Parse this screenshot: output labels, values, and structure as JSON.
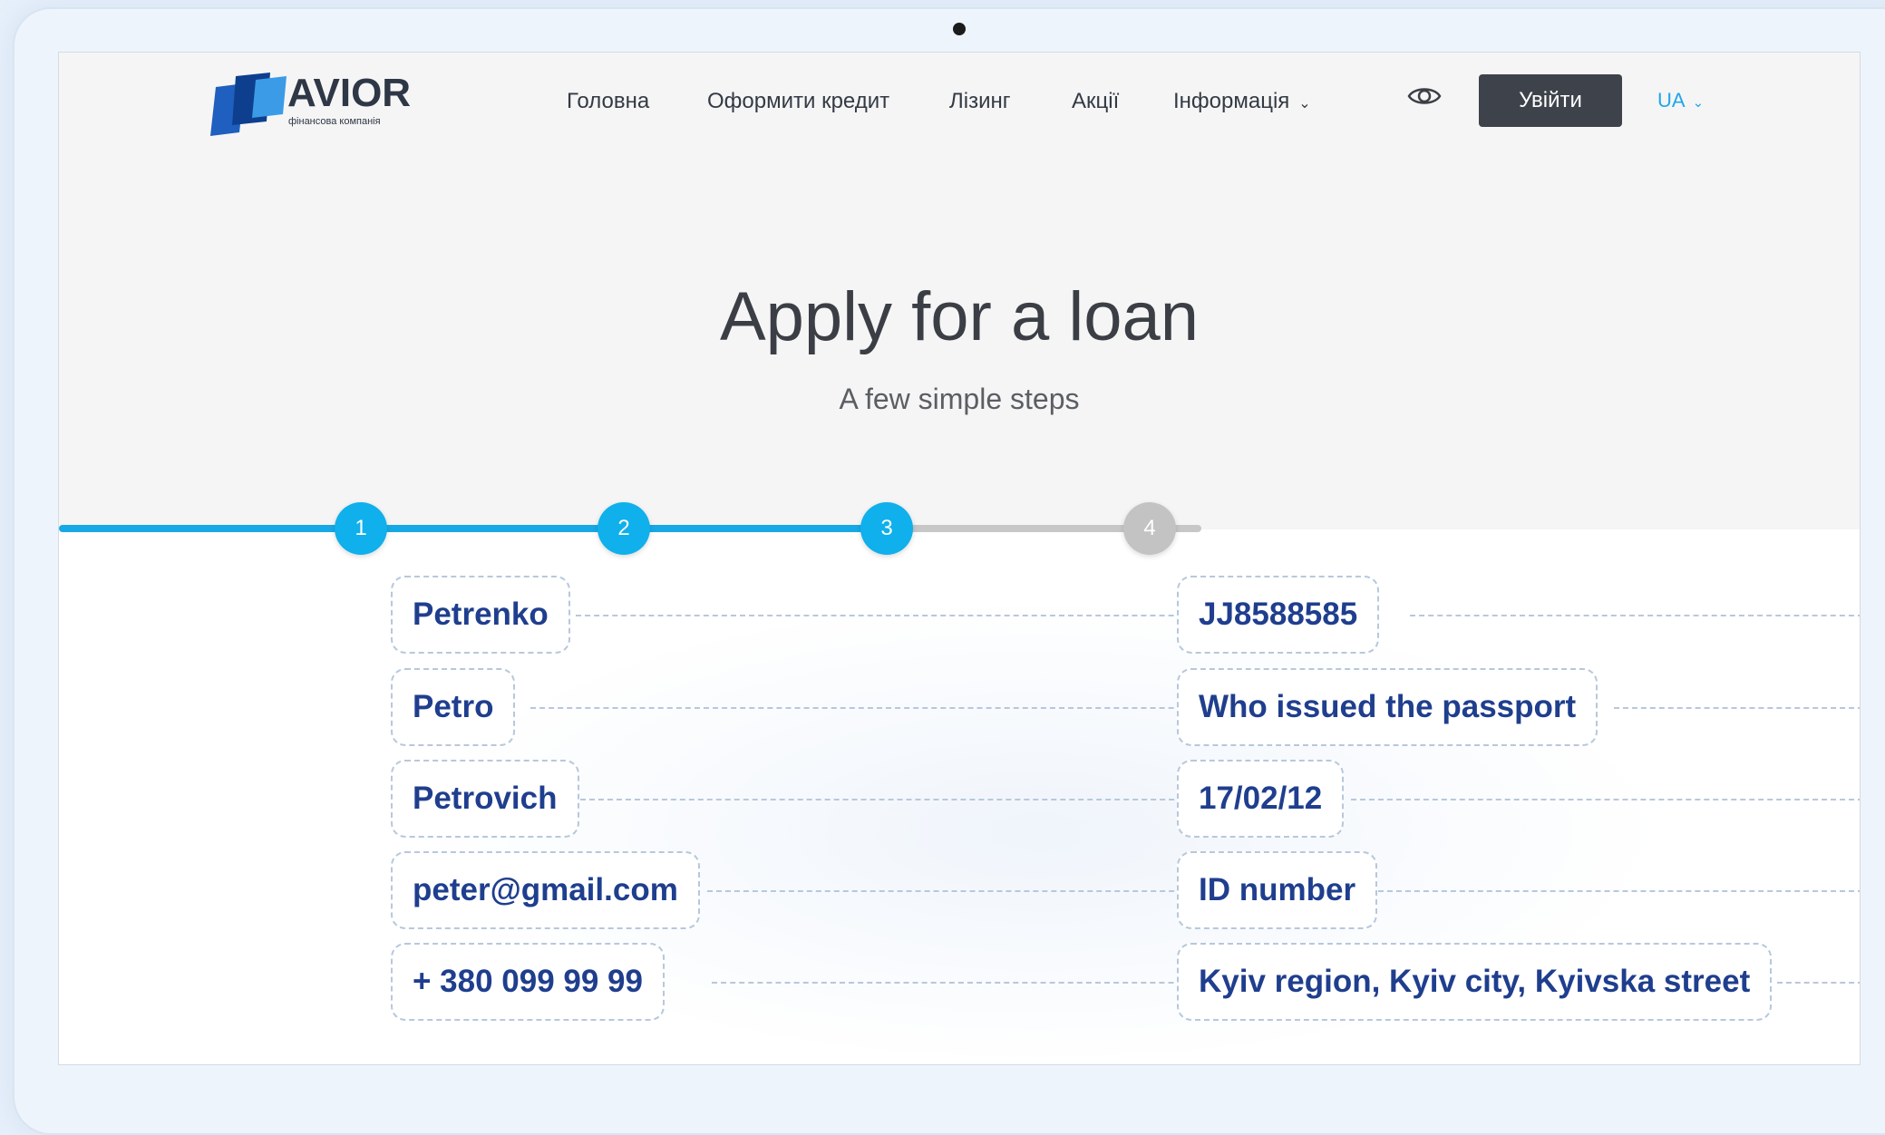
{
  "brand": {
    "name": "AVIOR",
    "tagline": "фінансова компанія",
    "colors": {
      "primary": "#1e5fbf",
      "dark": "#0e3f8e",
      "light": "#3b9be6"
    }
  },
  "nav": {
    "items": [
      {
        "label": "Головна"
      },
      {
        "label": "Оформити кредит"
      },
      {
        "label": "Лізинг"
      },
      {
        "label": "Акції"
      },
      {
        "label": "Інформація"
      }
    ],
    "eye_icon": "eye-icon",
    "login_label": "Увійти",
    "language": "UA"
  },
  "hero": {
    "title": "Apply for a loan",
    "subtitle": "A few simple steps"
  },
  "stepper": {
    "steps": [
      "1",
      "2",
      "3",
      "4"
    ],
    "current": 3,
    "active_color": "#17a9e6",
    "inactive_color": "#c3c3c3"
  },
  "form": {
    "left": [
      {
        "value": "Petrenko"
      },
      {
        "value": "Petro"
      },
      {
        "value": "Petrovich"
      },
      {
        "value": "peter@gmail.com"
      },
      {
        "value": "+ 380 099 99 99"
      }
    ],
    "right": [
      {
        "value": "JJ8588585"
      },
      {
        "value": "Who issued the passport"
      },
      {
        "value": "17/02/12"
      },
      {
        "value": "ID number"
      },
      {
        "value": "Kyiv region, Kyiv city, Kyivska street"
      }
    ],
    "text_color": "#1f3e8e"
  }
}
